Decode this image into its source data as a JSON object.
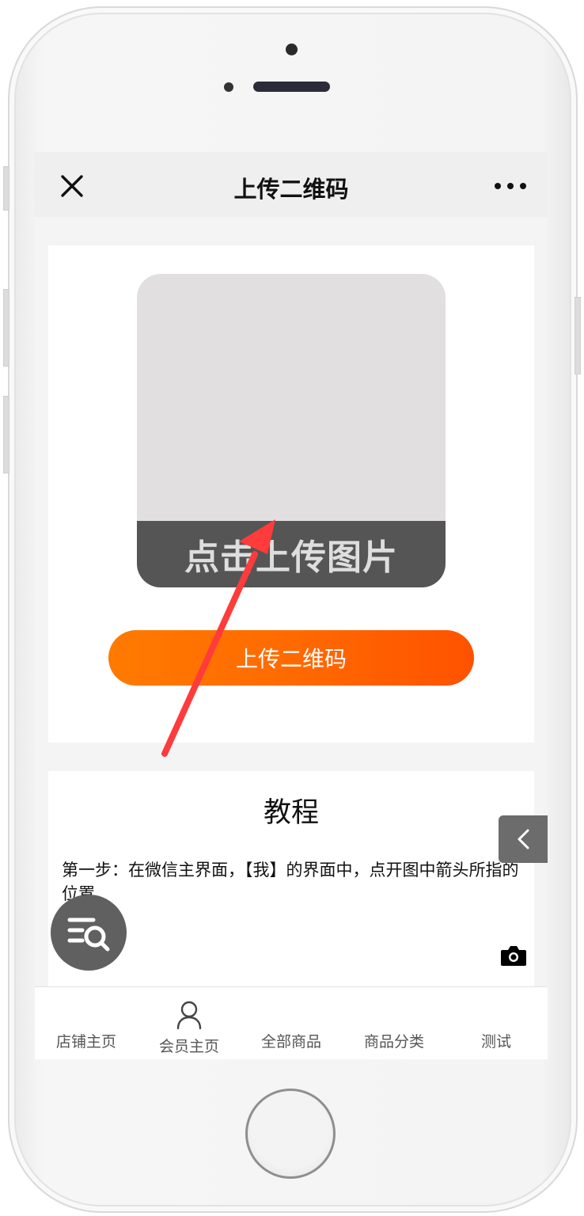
{
  "nav": {
    "title": "上传二维码",
    "close_icon": "close-icon",
    "more_icon": "more-icon"
  },
  "upload": {
    "strip_text": "点击上传图片",
    "button_label": "上传二维码"
  },
  "tutorial": {
    "title": "教程",
    "step_text": "第一步：在微信主界面，【我】的界面中，点开图中箭头所指的位置",
    "camera_icon": "camera-icon"
  },
  "floating": {
    "search_icon": "list-search-icon",
    "back_icon": "chevron-left-icon"
  },
  "tabs": [
    {
      "label": "店铺主页"
    },
    {
      "label": "会员主页",
      "icon": "user-icon"
    },
    {
      "label": "全部商品"
    },
    {
      "label": "商品分类"
    },
    {
      "label": "测试"
    }
  ],
  "colors": {
    "accent_orange": "#ff6a00",
    "arrow_red": "#ff3b3b",
    "upload_strip": "#555555",
    "upload_box": "#e1dfdf"
  }
}
